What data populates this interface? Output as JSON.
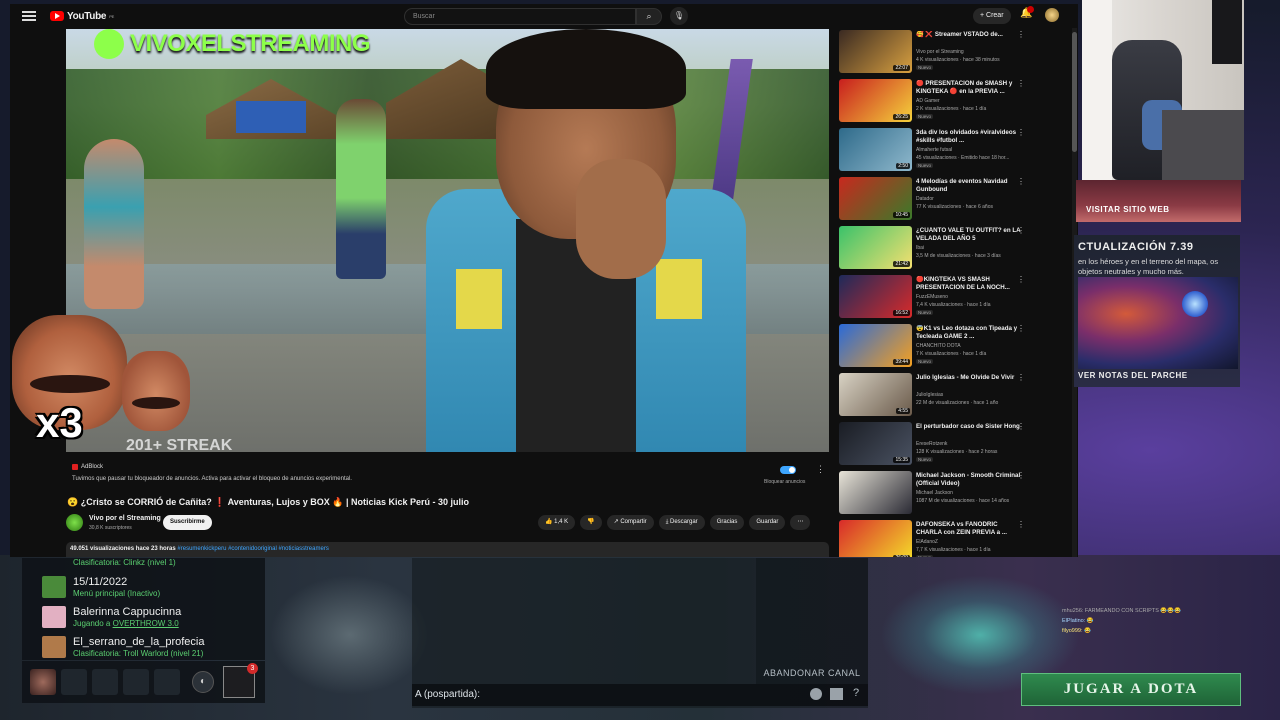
{
  "youtube": {
    "logo": "YouTube",
    "logo_region": "PE",
    "search_placeholder": "Buscar",
    "create_label": "+ Crear",
    "video": {
      "brand_overlay": "VIVOXELSTREAMING",
      "streak_text": "201+ STREAK",
      "meme_text": "x3"
    },
    "adblock": {
      "name": "AdBlock",
      "message": "Tuvimos que pausar tu bloqueador de anuncios. Activa para activar el bloqueo de anuncios experimental.",
      "toggle_label": "Bloquear anuncios"
    },
    "video_title": "😮 ¿Cristo se CORRIÓ de Cañita? ❗ Aventuras, Lujos y BOX 🔥 | Noticias Kick Perú - 30 julio",
    "channel_name": "Vivo por el Streaming",
    "channel_subs": "30,8 K suscriptores",
    "subscribe_label": "Suscribirme",
    "actions": {
      "likes": "👍 1,4 K",
      "dislike": "👎",
      "share": "↗ Compartir",
      "download": "⤓ Descargar",
      "thanks": "Gracias",
      "save": "Guardar",
      "more": "⋯"
    },
    "description": {
      "views": "49.051 visualizaciones  hace 23 horas",
      "tags": " #resumenkickperu #contenidooriginal #noticiasstreamers"
    },
    "recommendations": [
      {
        "title": "🥰 ❌ Streamer VSTADO de...",
        "channel": "Vivo por el Streaming",
        "views": "4 K visualizaciones · hace 38 minutos",
        "badge": "Nuevo",
        "duration": "22:07",
        "c1": "#3a2a22",
        "c2": "#d8a040"
      },
      {
        "title": "🔴 PRESENTACIÓN de SMASH y KINGTEKA 🔴 en la PREVIA ...",
        "channel": "AD Gamer",
        "views": "2 K visualizaciones · hace 1 día",
        "badge": "Nuevo",
        "duration": "26:25",
        "c1": "#c81e1e",
        "c2": "#f5d23c"
      },
      {
        "title": "3da div los olvidados #viralvideos #skills #futbol ...",
        "channel": "Almaherte futsal",
        "views": "45 visualizaciones · Emitido hace 18 hor...",
        "badge": "Nuevo",
        "duration": "2:50",
        "c1": "#2e6a8a",
        "c2": "#8fb8cc"
      },
      {
        "title": "4 Melodías de eventos Navidad Gunbound",
        "channel": "Datador",
        "views": "77 K visualizaciones · hace 6 años",
        "badge": "",
        "duration": "10:45",
        "c1": "#c8281e",
        "c2": "#3a7a2a"
      },
      {
        "title": "¿CUÁNTO VALE TU OUTFIT? en LA VELADA DEL AÑO 5",
        "channel": "Ibai",
        "views": "3,5 M de visualizaciones · hace 3 días",
        "badge": "",
        "duration": "21:42",
        "c1": "#3ac26a",
        "c2": "#f5e070"
      },
      {
        "title": "🔴KINGTEKA VS SMASH PRESENTACION DE LA NOCH...",
        "channel": "FuzzEMuseno",
        "views": "7,4 K visualizaciones · hace 1 día",
        "badge": "Nuevo",
        "duration": "16:52",
        "c1": "#1e2a5a",
        "c2": "#d82a2a"
      },
      {
        "title": "😨K1 vs Leo dotaza con Tipeada y Tecleada GAME 2 ...",
        "channel": "CHANCHITO DOTA",
        "views": "7 K visualizaciones · hace 1 día",
        "badge": "Nuevo",
        "duration": "39:44",
        "c1": "#2a6ad8",
        "c2": "#f5a020"
      },
      {
        "title": "Julio Iglesias - Me Olvide De Vivir",
        "channel": "JulioIglesias",
        "views": "22 M de visualizaciones · hace 1 año",
        "badge": "",
        "duration": "4:55",
        "c1": "#d8d2c4",
        "c2": "#6a5a4a"
      },
      {
        "title": "El perturbador caso de Sister Hong",
        "channel": "EreseRotzenk",
        "views": "128 K visualizaciones · hace 2 horas",
        "badge": "Nuevo",
        "duration": "15:35",
        "c1": "#1a1d24",
        "c2": "#4a5262"
      },
      {
        "title": "Michael Jackson - Smooth Criminal (Official Video)",
        "channel": "Michael Jackson",
        "views": "1087 M de visualizaciones · hace 14 años",
        "badge": "",
        "duration": "",
        "c1": "#e8e4d8",
        "c2": "#2a2a34"
      },
      {
        "title": "DAFONSEKA vs FANODRIC CHARLA con ZEIN PREVIA a ...",
        "channel": "ElAdanoZ",
        "views": "7,7 K visualizaciones · hace 1 día",
        "badge": "Nuevo",
        "duration": "26:09",
        "c1": "#d82a2a",
        "c2": "#f5e02a"
      }
    ]
  },
  "webcam_button": "VISITAR SITIO WEB",
  "patch": {
    "heading": "CTUALIZACIÓN 7.39",
    "text": "en los héroes y en el terreno del mapa, os objetos neutrales y mucho más.",
    "footer": "VER NOTAS DEL PARCHE"
  },
  "right_chat": [
    "mhu256: FARMEANDO CON SCRIPTS 😂😂😂",
    "ElPlatino: 😂",
    "filyo999: 😂"
  ],
  "play_button": "JUGAR A DOTA",
  "friends": [
    {
      "name": "",
      "status": "Clasificatoria: Clinkz (nivel 1)",
      "av": "#8a5a3a"
    },
    {
      "name": "15/11/2022",
      "status": "Menú principal (Inactivo)",
      "av": "#4a8a3a"
    },
    {
      "name": "Balerinna Cappucinna",
      "status_prefix": "Jugando a ",
      "status_link": "OVERTHROW 3.0",
      "av": "#e2b0c2"
    },
    {
      "name": "El_serrano_de_la_profecia",
      "status": "Clasificatoria: Troll Warlord (nivel 21)",
      "av": "#b07a4a"
    }
  ],
  "party_badge": "3",
  "channel": {
    "leave_label": "ABANDONAR CANAL",
    "input_label": "A (pospartida):",
    "help": "?"
  }
}
